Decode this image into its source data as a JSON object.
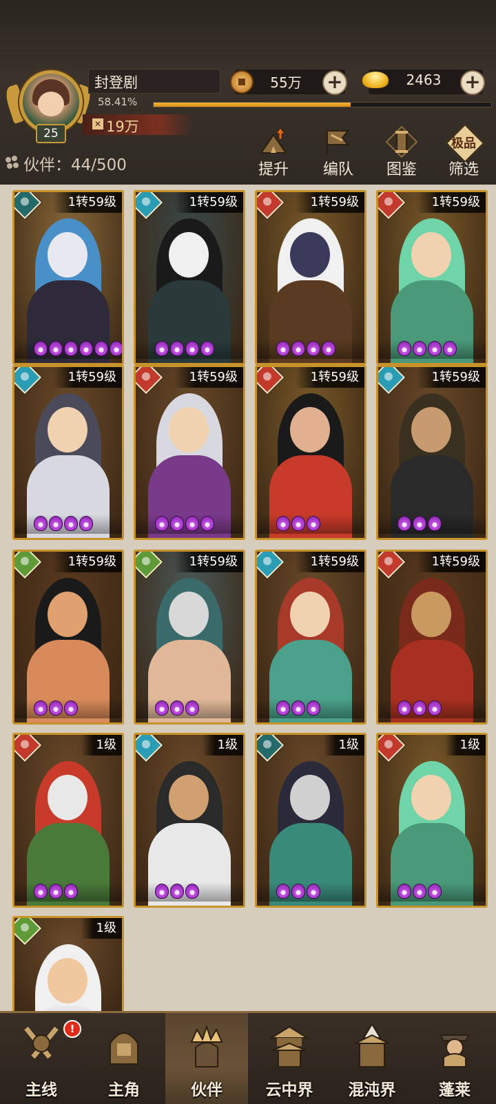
{
  "player": {
    "name": "封登剧",
    "level": "25",
    "exp_percent": "58.41%",
    "exp_fraction": 0.5841,
    "power": "19万"
  },
  "resources": {
    "copper": "55万",
    "gold": "2463"
  },
  "partners": {
    "count_label": "伙伴：44/500"
  },
  "actions": [
    {
      "label": "提升",
      "icon": "upgrade-icon"
    },
    {
      "label": "编队",
      "icon": "formation-icon"
    },
    {
      "label": "图鉴",
      "icon": "codex-icon"
    },
    {
      "label": "筛选",
      "icon": "filter-icon",
      "badge": "极品"
    }
  ],
  "cards": [
    {
      "level": "1转59级",
      "element": "dark",
      "stars": 6
    },
    {
      "level": "1转59级",
      "element": "water",
      "stars": 4
    },
    {
      "level": "1转59级",
      "element": "fire",
      "stars": 4
    },
    {
      "level": "1转59级",
      "element": "fire",
      "stars": 4
    },
    {
      "level": "1转59级",
      "element": "water",
      "stars": 4
    },
    {
      "level": "1转59级",
      "element": "fire",
      "stars": 4
    },
    {
      "level": "1转59级",
      "element": "fire",
      "stars": 3
    },
    {
      "level": "1转59级",
      "element": "water",
      "stars": 3
    },
    {
      "level": "1转59级",
      "element": "wood",
      "stars": 3
    },
    {
      "level": "1转59级",
      "element": "wood",
      "stars": 3
    },
    {
      "level": "1转59级",
      "element": "water",
      "stars": 3
    },
    {
      "level": "1转59级",
      "element": "fire",
      "stars": 3
    },
    {
      "level": "1级",
      "element": "fire",
      "stars": 3
    },
    {
      "level": "1级",
      "element": "water",
      "stars": 3
    },
    {
      "level": "1级",
      "element": "dark",
      "stars": 3
    },
    {
      "level": "1级",
      "element": "fire",
      "stars": 3
    },
    {
      "level": "1级",
      "element": "wood",
      "stars": 0
    }
  ],
  "nav": [
    {
      "label": "主线",
      "icon": "crossed-swords-icon",
      "alert": "!"
    },
    {
      "label": "主角",
      "icon": "hero-helmet-icon"
    },
    {
      "label": "伙伴",
      "icon": "partner-crown-icon",
      "active": true
    },
    {
      "label": "云中界",
      "icon": "pagoda-icon"
    },
    {
      "label": "混沌界",
      "icon": "chaos-temple-icon"
    },
    {
      "label": "蓬莱",
      "icon": "immortal-icon"
    }
  ],
  "colors": {
    "accent_gold": "#c8922a",
    "exp_bar": "#f3b63a",
    "star_purple": "#c04ee0",
    "alert_red": "#e02a1a"
  }
}
